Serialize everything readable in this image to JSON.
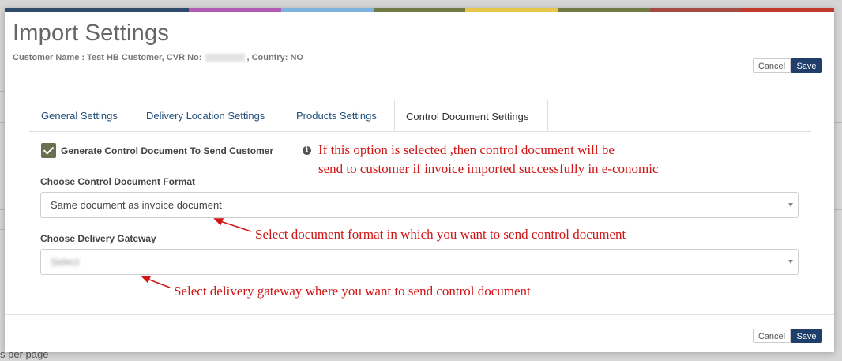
{
  "colorbar": [
    "#2f4a6b",
    "#2f4a6b",
    "#b15bb5",
    "#7eb2dc",
    "#6f7a44",
    "#e5c84a",
    "#6f7a44",
    "#a44a45",
    "#c0392b"
  ],
  "modal": {
    "title": "Import Settings",
    "customer_prefix": "Customer Name : Test HB Customer, CVR No:",
    "cvr_value": "87200720",
    "country_suffix": ", Country: NO",
    "cancel_label": "Cancel",
    "save_label": "Save"
  },
  "tabs": [
    {
      "label": "General Settings",
      "active": false
    },
    {
      "label": "Delivery Location Settings",
      "active": false
    },
    {
      "label": "Products Settings",
      "active": false
    },
    {
      "label": "Control Document Settings",
      "active": true
    }
  ],
  "control": {
    "checkbox_label": "Generate Control Document To Send Customer",
    "checked": true,
    "info_icon": "info-circle-icon",
    "format_label": "Choose Control Document Format",
    "format_value": "Same document as invoice document",
    "gateway_label": "Choose Delivery Gateway",
    "gateway_value": "Select"
  },
  "annotations": {
    "checkbox_note_line1": "If this option is selected ,then control document will be",
    "checkbox_note_line2": "send to customer if invoice imported successfully in e-conomic",
    "format_note": "Select document format in which you want to send control document",
    "gateway_note": "Select delivery gateway where you want to send control document"
  },
  "background": {
    "footer_text": "s per page"
  },
  "colors": {
    "save_button": "#1f3f6a",
    "checkbox": "#6b7150",
    "annotation": "#d11414",
    "tab_link": "#1f4e79"
  }
}
